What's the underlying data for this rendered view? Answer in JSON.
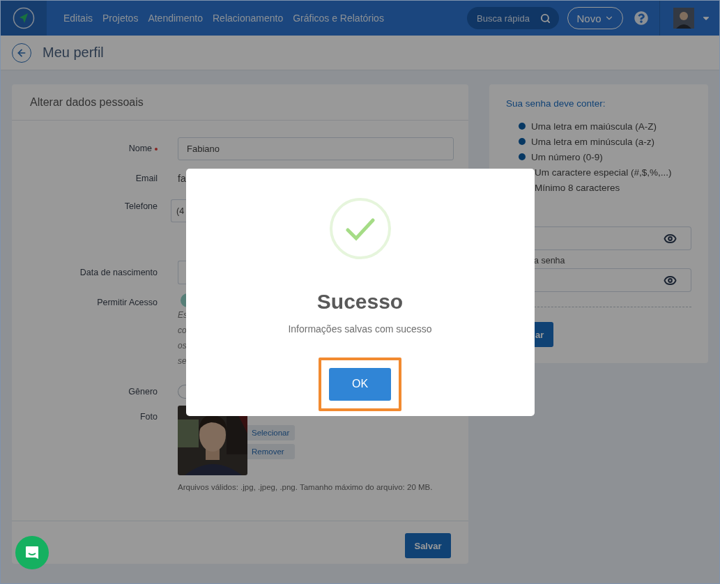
{
  "navbar": {
    "menu": [
      "Editais",
      "Projetos",
      "Atendimento",
      "Relacionamento",
      "Gráficos e Relatórios"
    ],
    "search": {
      "placeholder": "Busca rápida"
    },
    "new_button": "Novo"
  },
  "page_title": "Meu perfil",
  "personal_card": {
    "title": "Alterar dados pessoais",
    "fields": [
      {
        "kind": "input",
        "label": "Nome",
        "required": true,
        "value": "Fabiano"
      },
      {
        "kind": "text",
        "label": "Email",
        "value": "fa"
      },
      {
        "kind": "stub",
        "label": "Telefone",
        "value": "(4"
      },
      {
        "kind": "stub",
        "label": "Data de nascimento"
      },
      {
        "kind": "toggle",
        "label": "Permitir Acesso",
        "on": true,
        "note_lines": [
          "Es",
          "co",
          "os",
          "se"
        ]
      },
      {
        "kind": "radio",
        "label": "Gênero",
        "checked": false
      },
      {
        "label": "Foto",
        "buttons": [
          "Selecionar",
          "Remover"
        ],
        "hint": "Arquivos válidos: .jpg, .jpeg, .png. Tamanho máximo do arquivo: 20 MB."
      }
    ],
    "save_button": "Salvar"
  },
  "password_card": {
    "title": "Sua senha deve conter:",
    "rules": [
      {
        "text": "Uma letra em maiúscula (A-Z)",
        "bullet": true
      },
      {
        "text": "Uma letra em minúscula (a-z)",
        "bullet": true
      },
      {
        "text": "Um número (0-9)",
        "bullet": true
      },
      {
        "text": "Um caractere especial (#,$,%,...)",
        "bullet": false
      },
      {
        "text": "Mínimo 8 caracteres",
        "bullet": false
      }
    ],
    "fields": [
      {
        "kind": "password"
      },
      {
        "kind": "password",
        "label": "a senha"
      }
    ],
    "save_button": "ar"
  },
  "dialog": {
    "title": "Sucesso",
    "message": "Informações salvas com sucesso",
    "ok_button": "OK",
    "focused": true
  }
}
